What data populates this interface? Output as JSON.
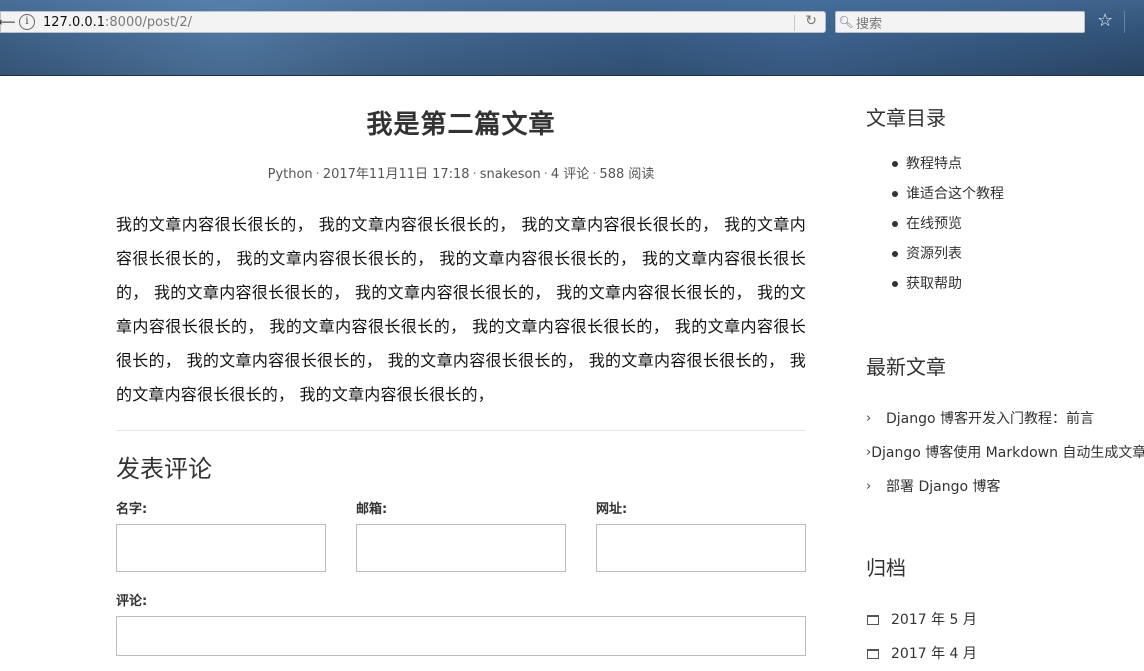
{
  "browser": {
    "url_host": "127.0.0.1",
    "url_rest": ":8000/post/2/",
    "search_placeholder": "搜索"
  },
  "post": {
    "title": "我是第二篇文章",
    "meta": {
      "category": "Python",
      "date": "2017年11月11日 17:18",
      "author": "snakeson",
      "comments": "4 评论",
      "views": "588 阅读"
    },
    "body": "我的文章内容很长很长的， 我的文章内容很长很长的， 我的文章内容很长很长的， 我的文章内容很长很长的， 我的文章内容很长很长的， 我的文章内容很长很长的， 我的文章内容很长很长的， 我的文章内容很长很长的， 我的文章内容很长很长的， 我的文章内容很长很长的， 我的文章内容很长很长的， 我的文章内容很长很长的， 我的文章内容很长很长的， 我的文章内容很长很长的， 我的文章内容很长很长的， 我的文章内容很长很长的， 我的文章内容很长很长的， 我的文章内容很长很长的， 我的文章内容很长很长的，"
  },
  "comment_form": {
    "title": "发表评论",
    "name_label": "名字:",
    "email_label": "邮箱:",
    "url_label": "网址:",
    "comment_label": "评论:"
  },
  "sidebar": {
    "toc_title": "文章目录",
    "toc_items": [
      "教程特点",
      "谁适合这个教程",
      "在线预览",
      "资源列表",
      "获取帮助"
    ],
    "recent_title": "最新文章",
    "recent_items": [
      "Django 博客开发入门教程：前言",
      "Django 博客使用 Markdown 自动生成文章",
      "部署 Django 博客"
    ],
    "archive_title": "归档",
    "archive_items": [
      "2017 年 5 月",
      "2017 年 4 月"
    ]
  }
}
